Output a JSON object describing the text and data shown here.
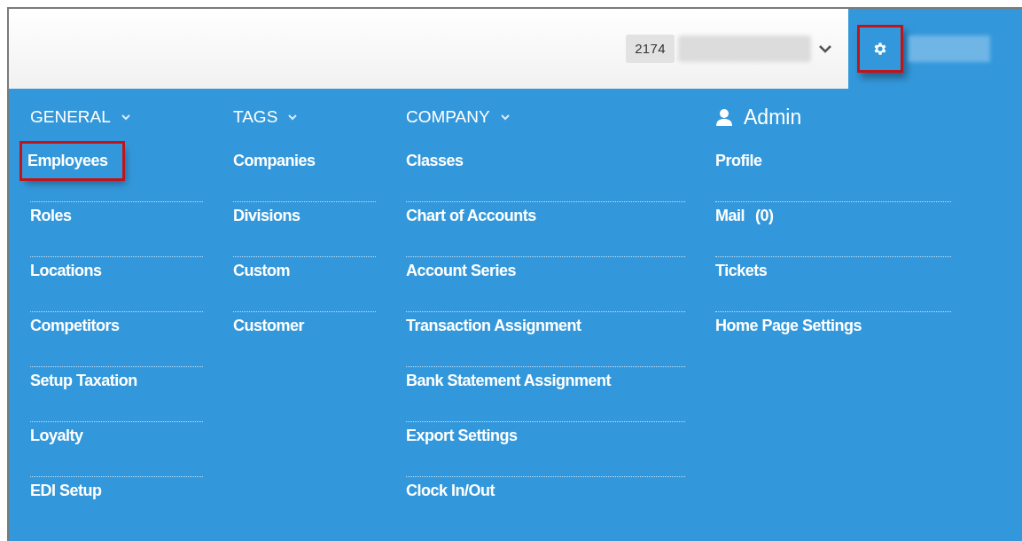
{
  "top_bar": {
    "company_code": "2174",
    "settings_highlighted": true
  },
  "columns": [
    {
      "title": "GENERAL",
      "kind": "dropdown",
      "items": [
        {
          "label": "Employees",
          "highlighted": true
        },
        {
          "label": "Roles",
          "highlighted": false
        },
        {
          "label": "Locations",
          "highlighted": false
        },
        {
          "label": "Competitors",
          "highlighted": false
        },
        {
          "label": "Setup Taxation",
          "highlighted": false
        },
        {
          "label": "Loyalty",
          "highlighted": false
        },
        {
          "label": "EDI Setup",
          "highlighted": false
        }
      ]
    },
    {
      "title": "TAGS",
      "kind": "dropdown",
      "items": [
        {
          "label": "Companies",
          "highlighted": false
        },
        {
          "label": "Divisions",
          "highlighted": false
        },
        {
          "label": "Custom",
          "highlighted": false
        },
        {
          "label": "Customer",
          "highlighted": false
        }
      ]
    },
    {
      "title": "COMPANY",
      "kind": "dropdown",
      "items": [
        {
          "label": "Classes",
          "highlighted": false
        },
        {
          "label": "Chart of Accounts",
          "highlighted": false
        },
        {
          "label": "Account Series",
          "highlighted": false
        },
        {
          "label": "Transaction Assignment",
          "highlighted": false
        },
        {
          "label": "Bank Statement Assignment",
          "highlighted": false
        },
        {
          "label": "Export Settings",
          "highlighted": false
        },
        {
          "label": "Clock In/Out",
          "highlighted": false
        }
      ]
    },
    {
      "title": "Admin",
      "kind": "user",
      "items": [
        {
          "label": "Profile",
          "highlighted": false
        },
        {
          "label": "Mail",
          "count": "(0)",
          "highlighted": false
        },
        {
          "label": "Tickets",
          "highlighted": false
        },
        {
          "label": "Home Page Settings",
          "highlighted": false
        }
      ]
    }
  ]
}
